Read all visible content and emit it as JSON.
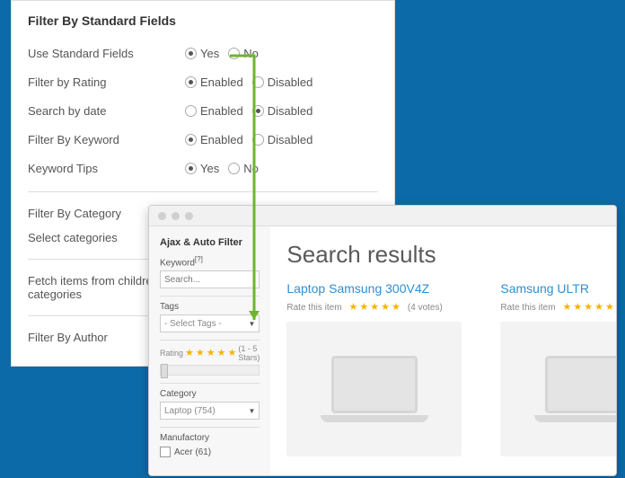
{
  "settings": {
    "title": "Filter By Standard Fields",
    "rows": [
      {
        "label": "Use Standard Fields",
        "options": [
          "Yes",
          "No"
        ],
        "selected": 0
      },
      {
        "label": "Filter by Rating",
        "options": [
          "Enabled",
          "Disabled"
        ],
        "selected": 0
      },
      {
        "label": "Search by date",
        "options": [
          "Enabled",
          "Disabled"
        ],
        "selected": 1
      },
      {
        "label": "Filter By Keyword",
        "options": [
          "Enabled",
          "Disabled"
        ],
        "selected": 0
      },
      {
        "label": "Keyword Tips",
        "options": [
          "Yes",
          "No"
        ],
        "selected": 0
      }
    ],
    "section_category": "Filter By Category",
    "select_categories": "Select categories",
    "fetch_note": "Fetch items from children categories",
    "section_author": "Filter By Author"
  },
  "filter": {
    "title": "Ajax & Auto Filter",
    "keyword_label": "Keyword",
    "keyword_sup": "[?]",
    "keyword_placeholder": "Search...",
    "tags_label": "Tags",
    "tags_selected": "- Select Tags -",
    "rating_label": "Rating",
    "rating_range": "(1 - 5 Stars)",
    "category_label": "Category",
    "category_selected": "Laptop (754)",
    "manufactory_label": "Manufactory",
    "manu_opt1": "Acer (61)"
  },
  "results": {
    "title": "Search results",
    "product1_title": "Laptop Samsung 300V4Z",
    "product2_title": "Samsung ULTR",
    "rate_label": "Rate this item",
    "votes": "(4 votes)"
  }
}
